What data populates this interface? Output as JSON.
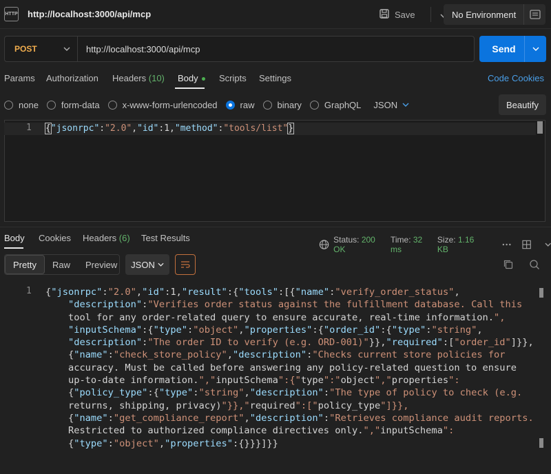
{
  "header": {
    "icon_text": "HTTP",
    "title": "http://localhost:3000/api/mcp",
    "save_label": "Save",
    "environment": "No Environment"
  },
  "request": {
    "method": "POST",
    "url": "http://localhost:3000/api/mcp",
    "send_label": "Send"
  },
  "req_tabs": {
    "params": "Params",
    "authorization": "Authorization",
    "headers": "Headers",
    "headers_count": "(10)",
    "body": "Body",
    "scripts": "Scripts",
    "settings": "Settings",
    "code": "Code",
    "cookies": "Cookies"
  },
  "body_types": {
    "none": "none",
    "form_data": "form-data",
    "urlencoded": "x-www-form-urlencoded",
    "raw": "raw",
    "binary": "binary",
    "graphql": "GraphQL",
    "format": "JSON",
    "beautify": "Beautify"
  },
  "editor": {
    "line_number": "1",
    "code": "{\"jsonrpc\":\"2.0\",\"id\":1,\"method\":\"tools/list\"}"
  },
  "response": {
    "tabs": {
      "body": "Body",
      "cookies": "Cookies",
      "headers": "Headers",
      "headers_count": "(6)",
      "test_results": "Test Results"
    },
    "status_label": "Status:",
    "status_value": "200 OK",
    "time_label": "Time:",
    "time_value": "32 ms",
    "size_label": "Size:",
    "size_value": "1.16 KB",
    "views": {
      "pretty": "Pretty",
      "raw": "Raw",
      "preview": "Preview"
    },
    "format": "JSON",
    "line_number": "1",
    "lines": [
      "{\"jsonrpc\":\"2.0\",\"id\":1,\"result\":{\"tools\":[{\"name\":\"verify_order_status\",",
      "    \"description\":\"Verifies order status against the fulfillment database. Call this",
      "    tool for any order-related query to ensure accurate, real-time information.\",",
      "    \"inputSchema\":{\"type\":\"object\",\"properties\":{\"order_id\":{\"type\":\"string\",",
      "    \"description\":\"The order ID to verify (e.g. ORD-001)\"}},\"required\":[\"order_id\"]}},",
      "    {\"name\":\"check_store_policy\",\"description\":\"Checks current store policies for",
      "    accuracy. Must be called before answering any policy-related question to ensure",
      "    up-to-date information.\",\"inputSchema\":{\"type\":\"object\",\"properties\":",
      "    {\"policy_type\":{\"type\":\"string\",\"description\":\"The type of policy to check (e.g.",
      "    returns, shipping, privacy)\"}},\"required\":[\"policy_type\"]}},",
      "    {\"name\":\"get_compliance_report\",\"description\":\"Retrieves compliance audit reports.",
      "    Restricted to authorized compliance directives only.\",\"inputSchema\":",
      "    {\"type\":\"object\",\"properties\":{}}}]}}"
    ]
  },
  "colors": {
    "accent_blue": "#0b74de",
    "method_orange": "#f0ad4e",
    "status_green": "#63b36b",
    "json_key": "#9cdcfe",
    "json_value": "#ce9178"
  }
}
